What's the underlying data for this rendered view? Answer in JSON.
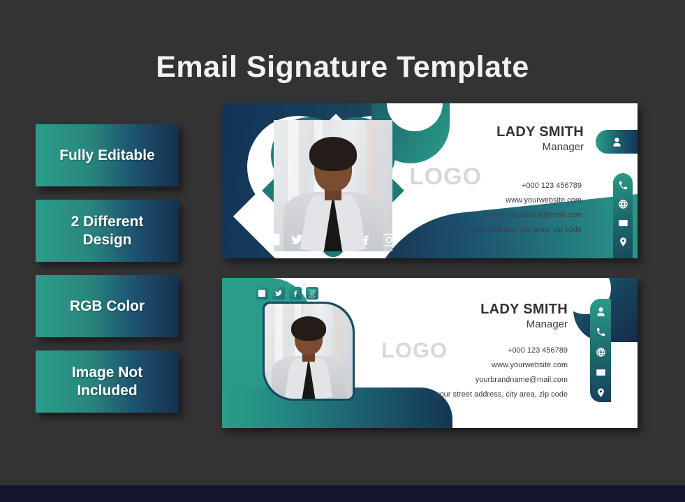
{
  "page": {
    "title": "Email Signature Template",
    "background_color": "#333333",
    "bottom_strip_color": "#12152c"
  },
  "features": [
    {
      "label": "Fully Editable"
    },
    {
      "label": "2 Different\nDesign"
    },
    {
      "label": "RGB Color"
    },
    {
      "label": "Image Not\nIncluded"
    }
  ],
  "colors": {
    "teal": "#2a9d8a",
    "navy": "#143654",
    "logo_gray": "#d8d8d8",
    "text_dark": "#2f3237"
  },
  "signature": {
    "name": "LADY SMITH",
    "role": "Manager",
    "logo_text": "LOGO",
    "phone": "+000 123 456789",
    "website": "www.yourwebsite.com",
    "email": "yourbrandname@mail.com",
    "address": "your street address, city area, zip code",
    "social": [
      "linkedin-icon",
      "twitter-icon",
      "facebook-icon",
      "instagram-icon"
    ],
    "contact_icons": [
      "person-icon",
      "phone-icon",
      "globe-icon",
      "envelope-icon",
      "location-pin-icon"
    ]
  },
  "cards": [
    {
      "name": "signature-card-design-one"
    },
    {
      "name": "signature-card-design-two"
    }
  ]
}
